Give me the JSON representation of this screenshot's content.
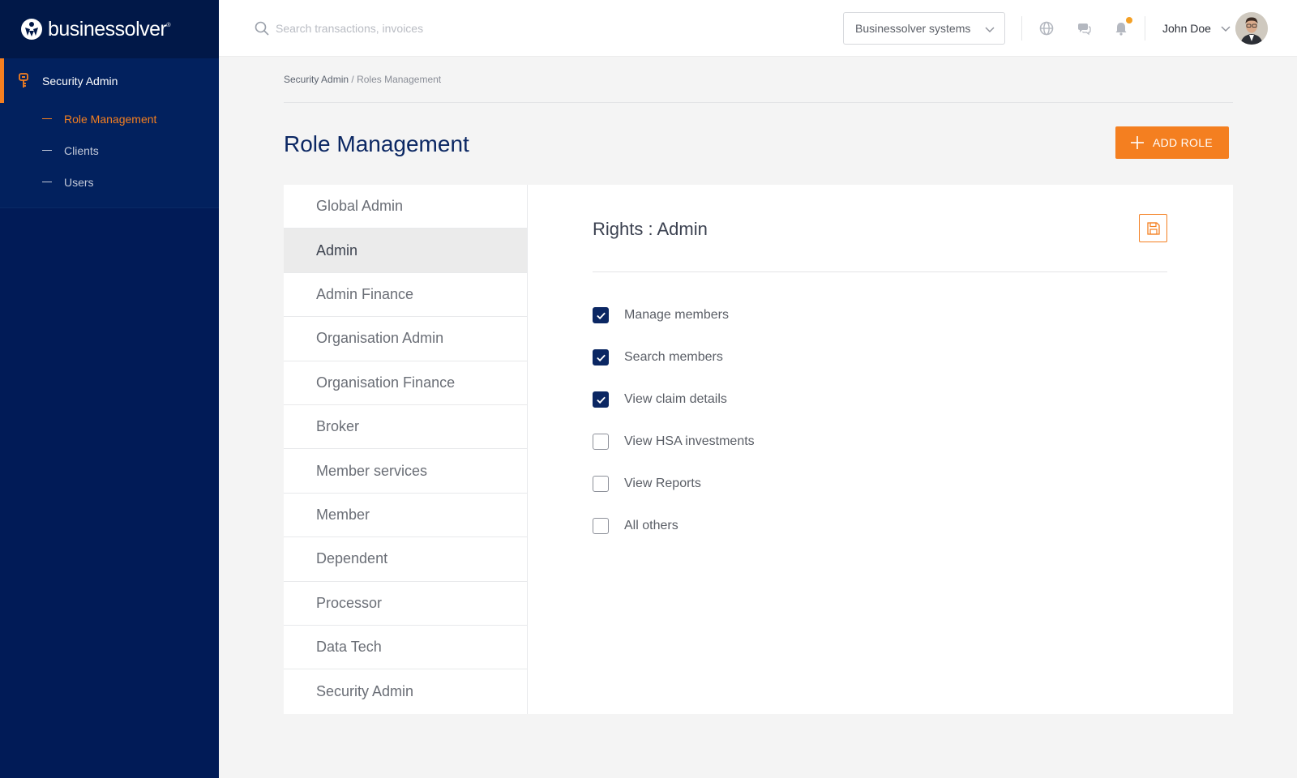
{
  "brand": {
    "name": "businessolver",
    "colors": {
      "accent": "#f47f20",
      "navy": "#011b57",
      "title": "#0b2763"
    }
  },
  "sidebar": {
    "section": {
      "label": "Security Admin",
      "icon": "key-icon"
    },
    "items": [
      {
        "label": "Role Management",
        "active": true
      },
      {
        "label": "Clients",
        "active": false
      },
      {
        "label": "Users",
        "active": false
      }
    ]
  },
  "topbar": {
    "search": {
      "placeholder": "Search transactions, invoices",
      "value": ""
    },
    "org_select": {
      "value": "Businessolver systems"
    },
    "icons": [
      "globe-icon",
      "chat-icon",
      "bell-icon"
    ],
    "user": {
      "name": "John Doe"
    }
  },
  "breadcrumb": {
    "root": "Security Admin",
    "separator": " / ",
    "current": "Roles Management"
  },
  "page": {
    "title": "Role Management",
    "add_button": "ADD ROLE"
  },
  "roles": [
    {
      "label": "Global Admin",
      "selected": false
    },
    {
      "label": "Admin",
      "selected": true
    },
    {
      "label": "Admin Finance",
      "selected": false
    },
    {
      "label": "Organisation Admin",
      "selected": false
    },
    {
      "label": "Organisation Finance",
      "selected": false
    },
    {
      "label": "Broker",
      "selected": false
    },
    {
      "label": "Member services",
      "selected": false
    },
    {
      "label": "Member",
      "selected": false
    },
    {
      "label": "Dependent",
      "selected": false
    },
    {
      "label": "Processor",
      "selected": false
    },
    {
      "label": "Data Tech",
      "selected": false
    },
    {
      "label": "Security Admin",
      "selected": false
    }
  ],
  "rights": {
    "title": "Rights : Admin",
    "items": [
      {
        "label": "Manage members",
        "checked": true
      },
      {
        "label": "Search members",
        "checked": true
      },
      {
        "label": "View claim details",
        "checked": true
      },
      {
        "label": "View HSA investments",
        "checked": false
      },
      {
        "label": "View Reports",
        "checked": false
      },
      {
        "label": "All others",
        "checked": false
      }
    ]
  }
}
